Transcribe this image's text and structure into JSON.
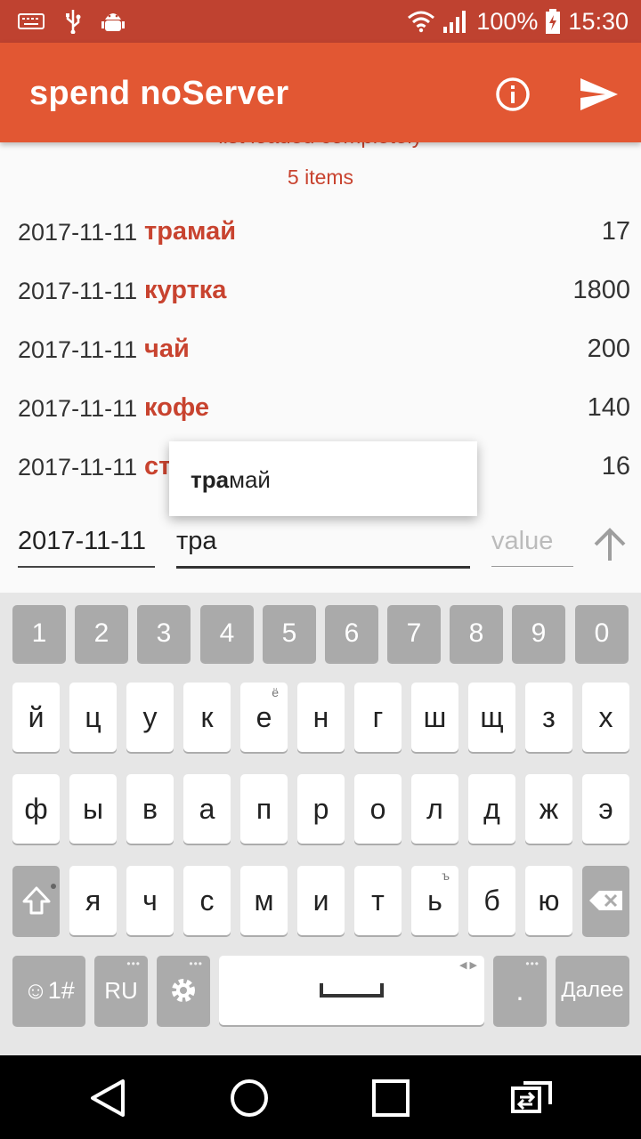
{
  "status_bar": {
    "battery": "100%",
    "time": "15:30",
    "icons": [
      "keyboard-icon",
      "usb-icon",
      "android-debug-icon",
      "wifi-icon",
      "signal-icon",
      "battery-charging-icon"
    ]
  },
  "app_bar": {
    "title": "spend noServer",
    "actions": [
      "info-icon",
      "send-icon"
    ]
  },
  "list": {
    "loaded_text": "list loaded completely",
    "count_text": "5 items",
    "rows": [
      {
        "date": "2017-11-11",
        "name": "трамай",
        "amount": "17"
      },
      {
        "date": "2017-11-11",
        "name": "куртка",
        "amount": "1800"
      },
      {
        "date": "2017-11-11",
        "name": "чай",
        "amount": "200"
      },
      {
        "date": "2017-11-11",
        "name": "кофе",
        "amount": "140"
      },
      {
        "date": "2017-11-11",
        "name": "ст",
        "amount": "16"
      }
    ]
  },
  "suggestion": {
    "match_bold": "тра",
    "match_rest": "май"
  },
  "input_row": {
    "date_value": "2017-11-11",
    "text_value": "тра",
    "value_placeholder": "value",
    "submit_icon": "arrow-up-icon"
  },
  "keyboard": {
    "numbers": [
      "1",
      "2",
      "3",
      "4",
      "5",
      "6",
      "7",
      "8",
      "9",
      "0"
    ],
    "row1": [
      "й",
      "ц",
      "у",
      "к",
      "е",
      "н",
      "г",
      "ш",
      "щ",
      "з",
      "х"
    ],
    "row1_hint_e": "ё",
    "row2": [
      "ф",
      "ы",
      "в",
      "а",
      "п",
      "р",
      "о",
      "л",
      "д",
      "ж",
      "э"
    ],
    "row3": [
      "я",
      "ч",
      "с",
      "м",
      "и",
      "т",
      "ь",
      "б",
      "ю"
    ],
    "row3_hint_soft": "ъ",
    "emoji_label": "☺1#",
    "lang_label": "RU",
    "period_label": ".",
    "enter_label": "Далее"
  },
  "nav_bar": {
    "buttons": [
      "back-icon",
      "home-icon",
      "recents-icon",
      "switch-app-icon"
    ]
  }
}
